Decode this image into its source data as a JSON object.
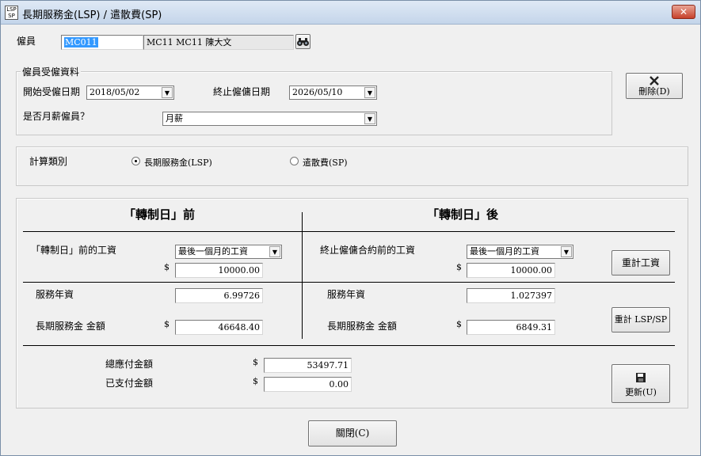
{
  "window": {
    "title": "長期服務金(LSP) / 遣散費(SP)",
    "icon_text": [
      "LSP",
      "SP"
    ],
    "close_label": "✕"
  },
  "employee": {
    "label": "僱員",
    "id_value": "MC011",
    "name_value": "MC11 MC11 陳大文",
    "search_icon": "binoculars-icon"
  },
  "employment": {
    "group_title": "僱員受僱資料",
    "start_label": "開始受僱日期",
    "start_value": "2018/05/02",
    "end_label": "終止僱傭日期",
    "end_value": "2026/05/10",
    "monthly_label": "是否月薪僱員？",
    "monthly_value": "月薪"
  },
  "delete_button": {
    "icon": "x-icon",
    "label": "刪除(D)"
  },
  "calc_type": {
    "label": "計算類別",
    "options": [
      {
        "label": "長期服務金(LSP)",
        "selected": true
      },
      {
        "label": "遣散費(SP)",
        "selected": false
      }
    ]
  },
  "before": {
    "title": "「轉制日」前",
    "wage_label": "「轉制日」前的工資",
    "wage_option": "最後一個月的工資",
    "currency": "$",
    "wage_value": "10000.00",
    "years_label": "服務年資",
    "years_value": "6.99726",
    "amount_label": "長期服務金 金額",
    "amount_value": "46648.40"
  },
  "after": {
    "title": "「轉制日」後",
    "wage_label": "終止僱傭合約前的工資",
    "wage_option": "最後一個月的工資",
    "currency": "$",
    "wage_value": "10000.00",
    "years_label": "服務年資",
    "years_value": "1.027397",
    "amount_label": "長期服務金 金額",
    "amount_value": "6849.31"
  },
  "recalc_wage_button": "重計工資",
  "recalc_lsp_button": "重計 LSP/SP",
  "totals": {
    "total_label": "總應付金額",
    "total_value": "53497.71",
    "paid_label": "已支付金額",
    "paid_value": "0.00",
    "currency": "$"
  },
  "update_button": {
    "icon": "floppy-disk-icon",
    "label": "更新(U)"
  },
  "close_button": "關閉(C)"
}
